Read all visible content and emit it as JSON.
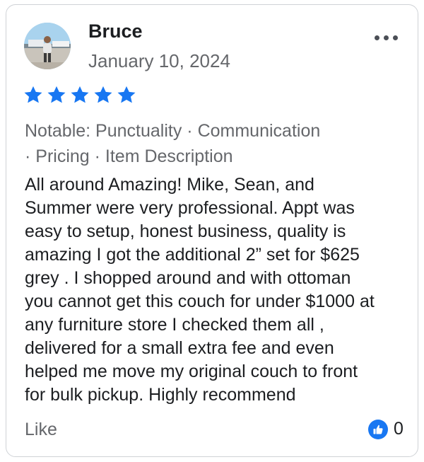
{
  "review": {
    "author": "Bruce",
    "date": "January 10, 2024",
    "rating": 5,
    "star_color": "#1877f2",
    "notable_line1": "Notable: Punctuality · Communication",
    "notable_line2": "· Pricing · Item Description",
    "text": "All around Amazing! Mike, Sean, and\nSummer were very professional. Appt was\neasy to setup, honest business, quality is\namazing I got the additional 2” set for $625\ngrey . I shopped around and with ottoman\nyou cannot get this couch for under $1000 at\nany furniture store I checked them all ,\ndelivered for a small extra fee and even\nhelped me move my original couch to front\nfor bulk pickup. Highly recommend",
    "like_label": "Like",
    "like_count": "0"
  },
  "icons": {
    "avatar": "profile-photo",
    "more": "more-options-icon",
    "star": "star-icon",
    "thumb": "thumbs-up-icon"
  }
}
